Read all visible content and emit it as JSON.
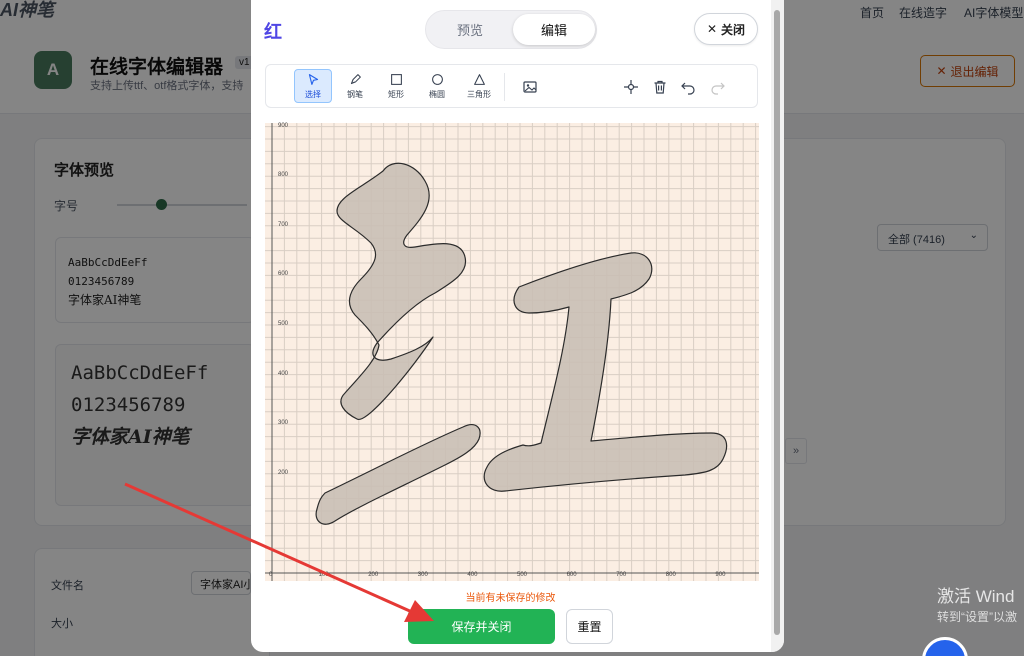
{
  "background": {
    "logo": "AI神笔",
    "nav": [
      "首页",
      "在线造字",
      "AI字体模型"
    ],
    "app_icon_letter": "A",
    "app_title": "在线字体编辑器",
    "version": "v1",
    "subtitle": "支持上传ttf、otf格式字体，支持",
    "exit_button": "退出编辑",
    "exit_icon": "close-x-icon",
    "preview_title": "字体预览",
    "size_label": "字号",
    "size_slider_level": 0.33,
    "sample_small": [
      "AaBbCcDdEeFf",
      "0123456789",
      "字体家AI神笔"
    ],
    "sample_large": [
      "AaBbCcDdEeFf",
      "0123456789",
      "字体家AI神笔"
    ],
    "filter_select": "全部 (7416)",
    "info_labels": [
      "文件名",
      "大小"
    ],
    "file_name_value": "字体家AI小",
    "pager_hint": "»",
    "windows_activation": [
      "激活 Wind",
      "转到“设置”以激"
    ]
  },
  "modal": {
    "glyph_char": "红",
    "tabs": [
      {
        "label": "预览",
        "active": false
      },
      {
        "label": "编辑",
        "active": true
      }
    ],
    "close_label": "关闭",
    "tools": [
      {
        "label": "选择",
        "icon": "cursor-arrow-icon",
        "active": true
      },
      {
        "label": "钢笔",
        "icon": "pen-icon",
        "active": false
      },
      {
        "label": "矩形",
        "icon": "rectangle-icon",
        "active": false
      },
      {
        "label": "椭圆",
        "icon": "ellipse-icon",
        "active": false
      },
      {
        "label": "三角形",
        "icon": "triangle-icon",
        "active": false
      }
    ],
    "actions": [
      "image-icon",
      "crosshair-icon",
      "trash-icon",
      "undo-icon",
      "redo-icon"
    ],
    "y_ticks": [
      "900",
      "800",
      "700",
      "600",
      "500",
      "400",
      "300",
      "200"
    ],
    "x_ticks": [
      "0",
      "100",
      "200",
      "300",
      "400",
      "500",
      "600",
      "700",
      "800",
      "900"
    ],
    "unsaved_notice": "当前有未保存的修改",
    "save_button": "保存并关闭",
    "reset_button": "重置"
  }
}
